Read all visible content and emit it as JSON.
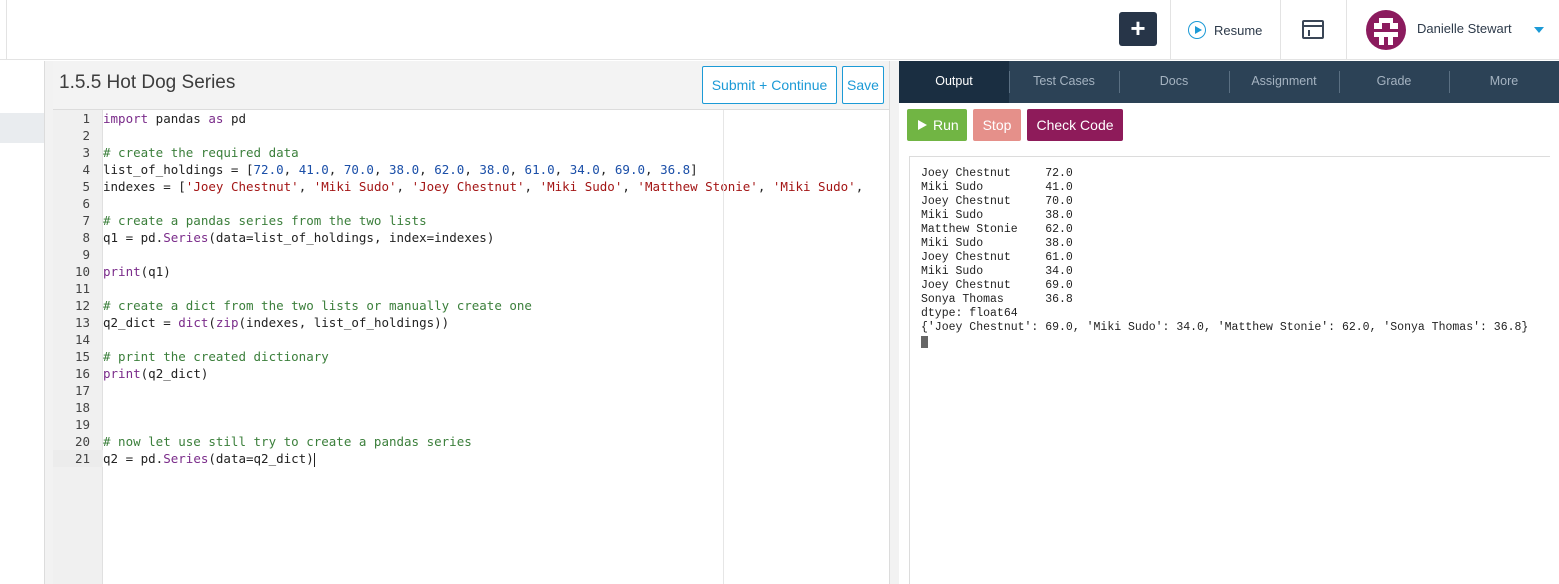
{
  "header": {
    "add_label": "+",
    "resume_label": "Resume",
    "user_name": "Danielle Stewart"
  },
  "editor": {
    "title": "1.5.5 Hot Dog Series",
    "submit_label": "Submit + Continue",
    "save_label": "Save",
    "line_numbers": [
      "1",
      "2",
      "3",
      "4",
      "5",
      "6",
      "7",
      "8",
      "9",
      "10",
      "11",
      "12",
      "13",
      "14",
      "15",
      "16",
      "17",
      "18",
      "19",
      "20",
      "21"
    ],
    "code": {
      "l1": [
        "import",
        " pandas ",
        "as",
        " pd"
      ],
      "l3": "# create the required data",
      "l4": [
        "list_of_holdings = [",
        "72.0",
        ", ",
        "41.0",
        ", ",
        "70.0",
        ", ",
        "38.0",
        ", ",
        "62.0",
        ", ",
        "38.0",
        ", ",
        "61.0",
        ", ",
        "34.0",
        ", ",
        "69.0",
        ", ",
        "36.8",
        "]"
      ],
      "l5": [
        "indexes = [",
        "'Joey Chestnut'",
        ", ",
        "'Miki Sudo'",
        ", ",
        "'Joey Chestnut'",
        ", ",
        "'Miki Sudo'",
        ", ",
        "'Matthew Stonie'",
        ", ",
        "'Miki Sudo'",
        ","
      ],
      "l7": "# create a pandas series from the two lists",
      "l8": [
        "q1 = pd.",
        "Series",
        "(data=list_of_holdings, index=indexes)"
      ],
      "l10": [
        "print",
        "(q1)"
      ],
      "l12": "# create a dict from the two lists or manually create one",
      "l13": [
        "q2_dict = ",
        "dict",
        "(",
        "zip",
        "(indexes, list_of_holdings))"
      ],
      "l15": "# print the created dictionary",
      "l16": [
        "print",
        "(q2_dict)"
      ],
      "l20": "# now let use still try to create a pandas series",
      "l21": [
        "q2 = pd.",
        "Series",
        "(data=q2_dict)"
      ]
    }
  },
  "tabs": [
    "Output",
    "Test Cases",
    "Docs",
    "Assignment",
    "Grade",
    "More"
  ],
  "actions": {
    "run_label": "Run",
    "stop_label": "Stop",
    "check_label": "Check Code"
  },
  "console": {
    "lines": [
      "Joey Chestnut     72.0",
      "Miki Sudo         41.0",
      "Joey Chestnut     70.0",
      "Miki Sudo         38.0",
      "Matthew Stonie    62.0",
      "Miki Sudo         38.0",
      "Joey Chestnut     61.0",
      "Miki Sudo         34.0",
      "Joey Chestnut     69.0",
      "Sonya Thomas      36.8",
      "dtype: float64",
      "{'Joey Chestnut': 69.0, 'Miki Sudo': 34.0, 'Matthew Stonie': 62.0, 'Sonya Thomas': 36.8}"
    ]
  },
  "colors": {
    "accent": "#1c9ad6",
    "nav_dark": "#273548",
    "tab_bar": "#2c4256",
    "run": "#71b544",
    "stop": "#e5908a",
    "check": "#8e1b5a"
  }
}
